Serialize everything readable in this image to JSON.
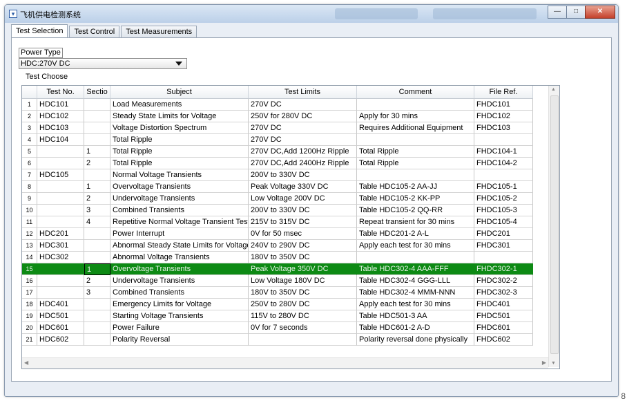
{
  "window": {
    "title": "飞机供电检测系统",
    "app_icon": "window-app-icon",
    "controls": {
      "minimize": "—",
      "maximize": "□",
      "close": "✕"
    }
  },
  "tabs": [
    {
      "label": "Test Selection",
      "active": true
    },
    {
      "label": "Test Control",
      "active": false
    },
    {
      "label": "Test Measurements",
      "active": false
    }
  ],
  "power_type": {
    "label": "Power Type",
    "selected": "HDC:270V DC"
  },
  "test_choose_label": "Test Choose",
  "table": {
    "headers": [
      "",
      "Test No.",
      "Sectio",
      "Subject",
      "Test Limits",
      "Comment",
      "File Ref."
    ],
    "selected_row_index": 14,
    "rows": [
      [
        "1",
        "HDC101",
        "",
        "Load Measurements",
        "270V DC",
        "",
        "FHDC101"
      ],
      [
        "2",
        "HDC102",
        "",
        "Steady State Limits for Voltage",
        "250V for 280V DC",
        "Apply for 30 mins",
        "FHDC102"
      ],
      [
        "3",
        "HDC103",
        "",
        "Voltage Distortion Spectrum",
        "270V DC",
        "Requires Additional Equipment",
        "FHDC103"
      ],
      [
        "4",
        "HDC104",
        "",
        "Total Ripple",
        "270V DC",
        "",
        ""
      ],
      [
        "5",
        "",
        "1",
        "Total Ripple",
        "270V DC,Add 1200Hz Ripple",
        "Total Ripple",
        "FHDC104-1"
      ],
      [
        "6",
        "",
        "2",
        "Total Ripple",
        "270V DC,Add 2400Hz Ripple",
        "Total Ripple",
        "FHDC104-2"
      ],
      [
        "7",
        "HDC105",
        "",
        "Normal Voltage Transients",
        "200V to 330V DC",
        "",
        ""
      ],
      [
        "8",
        "",
        "1",
        "Overvoltage Transients",
        "Peak Voltage 330V DC",
        "Table HDC105-2 AA-JJ",
        "FHDC105-1"
      ],
      [
        "9",
        "",
        "2",
        "Undervoltage Transients",
        "Low Voltage 200V DC",
        "Table HDC105-2 KK-PP",
        "FHDC105-2"
      ],
      [
        "10",
        "",
        "3",
        "Combined Transients",
        "200V to 330V DC",
        "Table HDC105-2 QQ-RR",
        "FHDC105-3"
      ],
      [
        "11",
        "",
        "4",
        "Repetitive Normal Voltage Transient Test",
        "215V to 315V DC",
        "Repeat transient for 30 mins",
        "FHDC105-4"
      ],
      [
        "12",
        "HDC201",
        "",
        "Power Interrupt",
        "0V for 50 msec",
        "Table HDC201-2 A-L",
        "FHDC201"
      ],
      [
        "13",
        "HDC301",
        "",
        "Abnormal Steady State Limits for Voltage",
        "240V to 290V DC",
        "Apply each test for 30 mins",
        "FHDC301"
      ],
      [
        "14",
        "HDC302",
        "",
        "Abnormal Voltage Transients",
        "180V to 350V DC",
        "",
        ""
      ],
      [
        "15",
        "",
        "1",
        "Overvoltage Transients",
        "Peak Voltage 350V DC",
        "Table HDC302-4 AAA-FFF",
        "FHDC302-1"
      ],
      [
        "16",
        "",
        "2",
        "Undervoltage Transients",
        "Low Voltage 180V DC",
        "Table HDC302-4 GGG-LLL",
        "FHDC302-2"
      ],
      [
        "17",
        "",
        "3",
        "Combined Transients",
        "180V to 350V DC",
        "Table HDC302-4 MMM-NNN",
        "FHDC302-3"
      ],
      [
        "18",
        "HDC401",
        "",
        "Emergency Limits for Voltage",
        "250V to 280V DC",
        "Apply each test for 30 mins",
        "FHDC401"
      ],
      [
        "19",
        "HDC501",
        "",
        "Starting Voltage Transients",
        "115V to 280V DC",
        "Table HDC501-3 AA",
        "FHDC501"
      ],
      [
        "20",
        "HDC601",
        "",
        "Power Failure",
        "0V for 7 seconds",
        "Table HDC601-2 A-D",
        "FHDC601"
      ],
      [
        "21",
        "HDC602",
        "",
        "Polarity Reversal",
        "",
        "Polarity reversal done physically",
        "FHDC602"
      ]
    ]
  },
  "colors": {
    "selected_row": "#0d8a14",
    "window_frame": "#bcd0e8"
  },
  "corner_text": "8"
}
